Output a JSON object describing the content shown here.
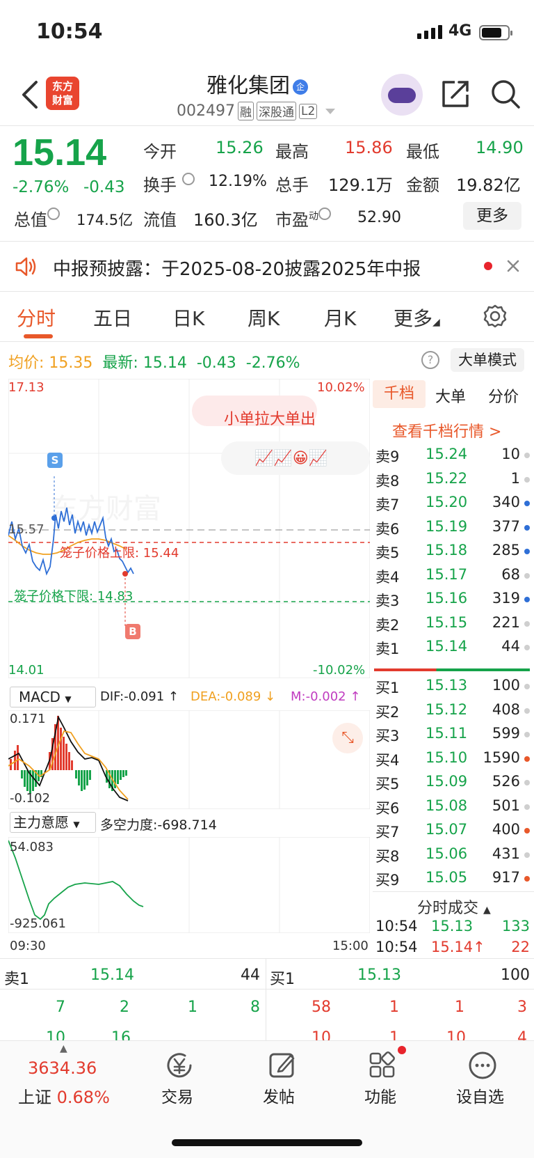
{
  "status": {
    "time": "10:54",
    "network": "4G"
  },
  "header": {
    "logo_line1": "东方",
    "logo_line2": "财富",
    "title": "雅化集团",
    "title_badge": "企",
    "code": "002497",
    "tags": [
      "融",
      "深股通",
      "L2"
    ]
  },
  "quote": {
    "price": "15.14",
    "change_pct": "-2.76%",
    "change_val": "-0.43",
    "open_label": "今开",
    "open": "15.26",
    "high_label": "最高",
    "high": "15.86",
    "low_label": "最低",
    "low": "14.90",
    "turnover_label": "换手",
    "turnover": "12.19%",
    "volume_label": "总手",
    "volume": "129.1万",
    "amount_label": "金额",
    "amount": "19.82亿",
    "mcap_label": "总值",
    "mcap": "174.5亿",
    "float_label": "流值",
    "float": "160.3亿",
    "pe_label": "市盈",
    "pe_sup": "动",
    "pe": "52.90",
    "more": "更多"
  },
  "notice": {
    "text": "中报预披露：于2025-08-20披露2025年中报"
  },
  "tabs": [
    "分时",
    "五日",
    "日K",
    "周K",
    "月K",
    "更多"
  ],
  "info": {
    "avg_label": "均价:",
    "avg": "15.35",
    "latest_label": "最新:",
    "latest": "15.14",
    "chg": "-0.43",
    "pct": "-2.76%",
    "mode": "大单模式"
  },
  "chart": {
    "y_top": "17.13",
    "y_bottom": "14.01",
    "pct_top": "10.02%",
    "pct_bottom": "-10.02%",
    "ref": "15.57",
    "promo": "小单拉大单出",
    "upper_limit": "笼子价格上限: 15.44",
    "lower_limit": "笼子价格下限: 14.83",
    "s_mark": "S",
    "b_mark": "B",
    "watermark": "东方财富"
  },
  "macd": {
    "name": "MACD",
    "dif": "DIF:-0.091 ↑",
    "dea": "DEA:-0.089 ↓",
    "m": "M:-0.002 ↑",
    "top": "0.171",
    "bottom": "-0.102"
  },
  "flow": {
    "name": "主力意愿",
    "strength": "多空力度:-698.714",
    "top": "54.083",
    "bottom": "-925.061"
  },
  "time_axis": {
    "start": "09:30",
    "end": "15:00"
  },
  "orderbook": {
    "tabs": [
      "千档",
      "大单",
      "分价"
    ],
    "link": "查看千档行情 >",
    "asks": [
      {
        "k": "卖9",
        "p": "15.24",
        "q": "10",
        "dot": "#cfcfcf"
      },
      {
        "k": "卖8",
        "p": "15.22",
        "q": "1",
        "dot": "#cfcfcf"
      },
      {
        "k": "卖7",
        "p": "15.20",
        "q": "340",
        "dot": "#2f6fd6"
      },
      {
        "k": "卖6",
        "p": "15.19",
        "q": "377",
        "dot": "#2f6fd6"
      },
      {
        "k": "卖5",
        "p": "15.18",
        "q": "285",
        "dot": "#2f6fd6"
      },
      {
        "k": "卖4",
        "p": "15.17",
        "q": "68",
        "dot": "#cfcfcf"
      },
      {
        "k": "卖3",
        "p": "15.16",
        "q": "319",
        "dot": "#2f6fd6"
      },
      {
        "k": "卖2",
        "p": "15.15",
        "q": "221",
        "dot": "#cfcfcf"
      },
      {
        "k": "卖1",
        "p": "15.14",
        "q": "44",
        "dot": "#cfcfcf"
      }
    ],
    "bids": [
      {
        "k": "买1",
        "p": "15.13",
        "q": "100",
        "dot": "#cfcfcf"
      },
      {
        "k": "买2",
        "p": "15.12",
        "q": "408",
        "dot": "#cfcfcf"
      },
      {
        "k": "买3",
        "p": "15.11",
        "q": "599",
        "dot": "#cfcfcf"
      },
      {
        "k": "买4",
        "p": "15.10",
        "q": "1590",
        "dot": "#e8582a"
      },
      {
        "k": "买5",
        "p": "15.09",
        "q": "526",
        "dot": "#cfcfcf"
      },
      {
        "k": "买6",
        "p": "15.08",
        "q": "501",
        "dot": "#cfcfcf"
      },
      {
        "k": "买7",
        "p": "15.07",
        "q": "400",
        "dot": "#e8582a"
      },
      {
        "k": "买8",
        "p": "15.06",
        "q": "431",
        "dot": "#cfcfcf"
      },
      {
        "k": "买9",
        "p": "15.05",
        "q": "917",
        "dot": "#e8582a"
      }
    ],
    "ticks_title": "分时成交",
    "ticks": [
      {
        "t": "10:54",
        "p": "15.13",
        "q": "133"
      },
      {
        "t": "10:54",
        "p": "15.14↑",
        "q": "22"
      }
    ]
  },
  "depth": {
    "sell_label": "卖1",
    "sell_price": "15.14",
    "sell_qty": "44",
    "buy_label": "买1",
    "buy_price": "15.13",
    "buy_qty": "100",
    "sell_row": [
      "7",
      "2",
      "1",
      "8"
    ],
    "buy_row": [
      "58",
      "1",
      "1",
      "3"
    ],
    "sell_row2": [
      "10",
      "16"
    ],
    "buy_row2": [
      "10",
      "1",
      "10",
      "4"
    ]
  },
  "bottom": {
    "index_value": "3634.36",
    "index_name": "上证",
    "index_pct": "0.68%",
    "items": [
      "交易",
      "发帖",
      "功能",
      "设自选"
    ]
  }
}
